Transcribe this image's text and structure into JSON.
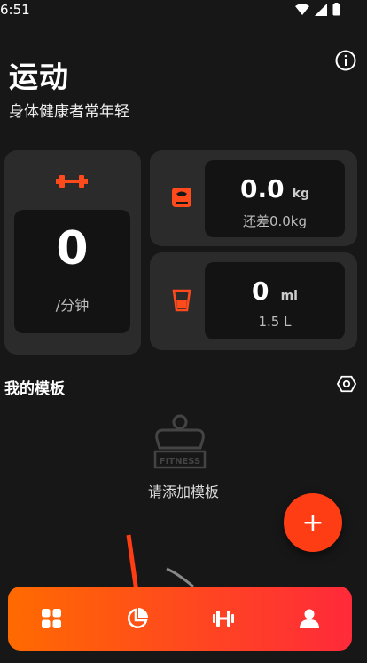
{
  "status_bar": {
    "time": "6:51"
  },
  "header": {
    "title": "运动",
    "subtitle": "身体健康者常年轻"
  },
  "cards": {
    "exercise": {
      "value": "0",
      "unit": "/分钟"
    },
    "weight": {
      "value": "0.0",
      "unit": "kg",
      "sub": "还差0.0kg"
    },
    "water": {
      "value": "0",
      "unit": "ml",
      "sub": "1.5 L"
    }
  },
  "templates": {
    "title": "我的模板",
    "empty_text": "请添加模板",
    "badge_text": "FITNESS"
  },
  "fab": {
    "label": "+"
  },
  "colors": {
    "accent": "#ff3d14",
    "nav_start": "#ff6a00",
    "nav_end": "#ff2a3a",
    "card": "#2b2b2b"
  },
  "nav": {
    "items": [
      "grid-icon",
      "pie-chart-icon",
      "dumbbell-icon",
      "user-icon"
    ]
  }
}
